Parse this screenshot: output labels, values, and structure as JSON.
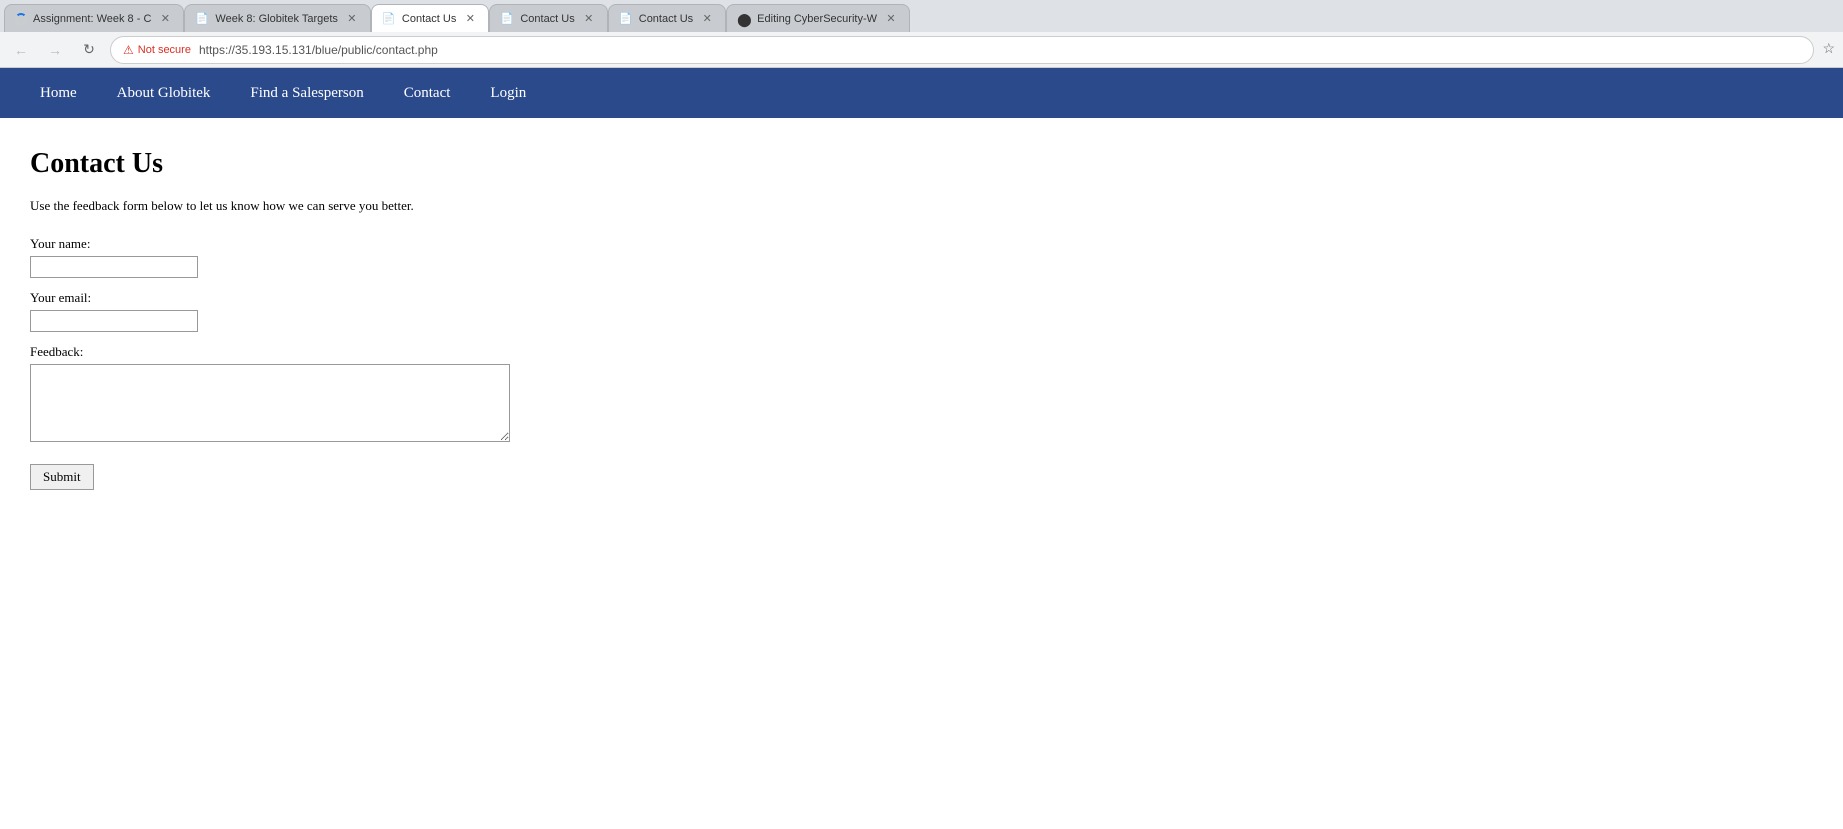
{
  "browser": {
    "tabs": [
      {
        "id": "tab-1",
        "title": "Assignment: Week 8 - C",
        "favicon_type": "spinner",
        "active": false,
        "closeable": true
      },
      {
        "id": "tab-2",
        "title": "Week 8: Globitek Targets",
        "favicon_type": "page",
        "active": false,
        "closeable": true
      },
      {
        "id": "tab-3",
        "title": "Contact Us",
        "favicon_type": "page",
        "active": true,
        "closeable": true
      },
      {
        "id": "tab-4",
        "title": "Contact Us",
        "favicon_type": "page",
        "active": false,
        "closeable": true
      },
      {
        "id": "tab-5",
        "title": "Contact Us",
        "favicon_type": "page",
        "active": false,
        "closeable": true
      },
      {
        "id": "tab-6",
        "title": "Editing CyberSecurity-W",
        "favicon_type": "github",
        "active": false,
        "closeable": true
      }
    ],
    "security_label": "Not secure",
    "url": "https://35.193.15.131/blue/public/contact.php",
    "back_disabled": true,
    "forward_disabled": true
  },
  "nav": {
    "items": [
      {
        "label": "Home",
        "href": "#"
      },
      {
        "label": "About Globitek",
        "href": "#"
      },
      {
        "label": "Find a Salesperson",
        "href": "#"
      },
      {
        "label": "Contact",
        "href": "#"
      },
      {
        "label": "Login",
        "href": "#"
      }
    ]
  },
  "page": {
    "title": "Contact Us",
    "subtitle": "Use the feedback form below to let us know how we can serve you better.",
    "form": {
      "name_label": "Your name:",
      "email_label": "Your email:",
      "feedback_label": "Feedback:",
      "submit_label": "Submit"
    }
  }
}
